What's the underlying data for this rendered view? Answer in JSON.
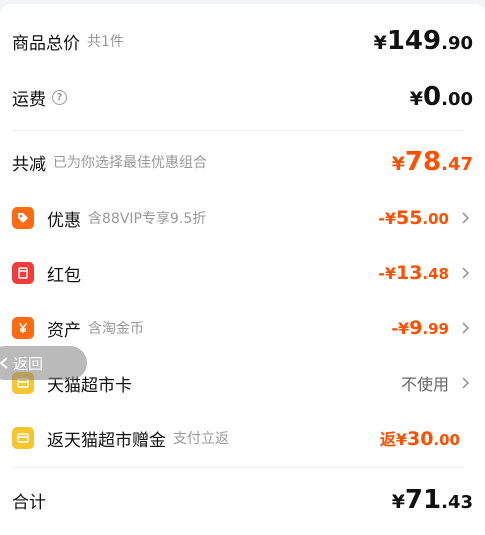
{
  "summary": {
    "goods_total": {
      "label": "商品总价",
      "sub": "共1件",
      "currency": "¥",
      "int": "149",
      "dec": ".90"
    },
    "shipping": {
      "label": "运费",
      "help_icon": "question-circle-icon",
      "currency": "¥",
      "int": "0",
      "dec": ".00"
    },
    "total_discount": {
      "label": "共减",
      "sub": "已为你选择最佳优惠组合",
      "currency": "¥",
      "int": "78",
      "dec": ".47"
    }
  },
  "discounts": [
    {
      "icon": "coupon-tag-icon",
      "icon_color": "#ff6a13",
      "label": "优惠",
      "sub": "含88VIP专享9.5折",
      "prefix": "-",
      "currency": "¥",
      "int": "55",
      "dec": ".00"
    },
    {
      "icon": "red-packet-icon",
      "icon_color": "#f23b3b",
      "label": "红包",
      "sub": "",
      "prefix": "-",
      "currency": "¥",
      "int": "13",
      "dec": ".48"
    },
    {
      "icon": "yen-asset-icon",
      "icon_color": "#ff6a13",
      "label": "资产",
      "sub": "含淘金币",
      "prefix": "-",
      "currency": "¥",
      "int": "9",
      "dec": ".99"
    }
  ],
  "tmall_card": {
    "icon": "card-icon",
    "icon_color": "#f7c52d",
    "label": "天猫超市卡",
    "value": "不使用"
  },
  "tmall_gift": {
    "icon": "card-icon",
    "icon_color": "#f7c52d",
    "label": "返天猫超市赠金",
    "sub": "支付立返",
    "prefix": "返",
    "currency": "¥",
    "int": "30",
    "dec": ".00"
  },
  "grand_total": {
    "label": "合计",
    "currency": "¥",
    "int": "71",
    "dec": ".43"
  },
  "back_button": {
    "label": "返回"
  },
  "colors": {
    "accent": "#ff5000",
    "muted": "#999999"
  }
}
